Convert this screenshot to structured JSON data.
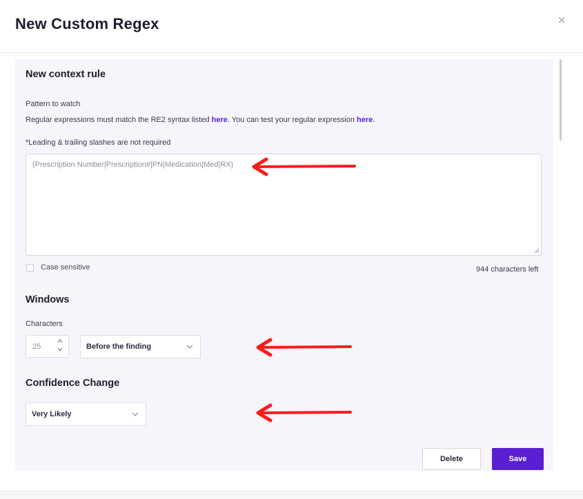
{
  "modal": {
    "title": "New Custom Regex",
    "close_glyph": "×"
  },
  "context_rule": {
    "title": "New context rule",
    "pattern_label": "Pattern to watch",
    "help_prefix": "Regular expressions must match the RE2 syntax listed ",
    "help_link1": "here",
    "help_middle": ". You can test your regular expression ",
    "help_link2": "here",
    "help_suffix": ".",
    "note": "*Leading & trailing slashes are not required",
    "pattern_value": "(Prescription Number|Prescription#|PN|Medication|Med|RX)",
    "case_sensitive_label": "Case sensitive",
    "case_sensitive_checked": false,
    "chars_left": "944 characters left"
  },
  "windows": {
    "title": "Windows",
    "characters_label": "Characters",
    "characters_value": "25",
    "position_value": "Before the finding"
  },
  "confidence": {
    "title": "Confidence Change",
    "value": "Very Likely"
  },
  "actions": {
    "delete_label": "Delete",
    "save_label": "Save"
  },
  "colors": {
    "accent": "#5a1fd1",
    "annotation_arrow": "#ff1a1a"
  },
  "icons": [
    "close-icon",
    "chevron-down-icon",
    "stepper-up-icon",
    "stepper-down-icon",
    "resize-grip-icon",
    "annotation-arrow"
  ]
}
